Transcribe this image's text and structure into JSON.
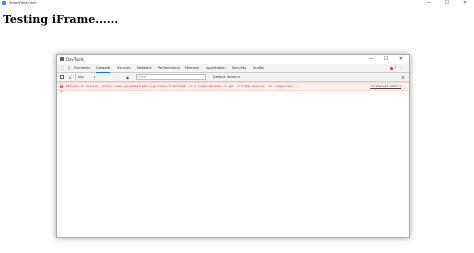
{
  "browser": {
    "title": "iframeTest.html",
    "controls": [
      "—",
      "☐",
      "✕"
    ]
  },
  "page": {
    "heading": "Testing iFrame......"
  },
  "devtools": {
    "title": "DevTools",
    "window_controls": [
      "—",
      "☐",
      "✕"
    ],
    "tabs": [
      "Elements",
      "Console",
      "Sources",
      "Network",
      "Performance",
      "Memory",
      "Application",
      "Security",
      "Audits"
    ],
    "active_tab": "Console",
    "error_count": "1",
    "more_icon": "⋮",
    "console_toolbar": {
      "context": "top",
      "filter_placeholder": "Filter",
      "levels": "Default levels ▾"
    },
    "error": {
      "message": "Refused to display 'https://www.yougamestreet.org/videos/f/zbf1bs8' in a frame because it set 'X-Frame-Options' to 'sameorigin'.",
      "source": "iframetest.html:1"
    },
    "prompt": ">"
  },
  "colors": {
    "error_red": "#d93025",
    "accent": "#1a73e8"
  }
}
